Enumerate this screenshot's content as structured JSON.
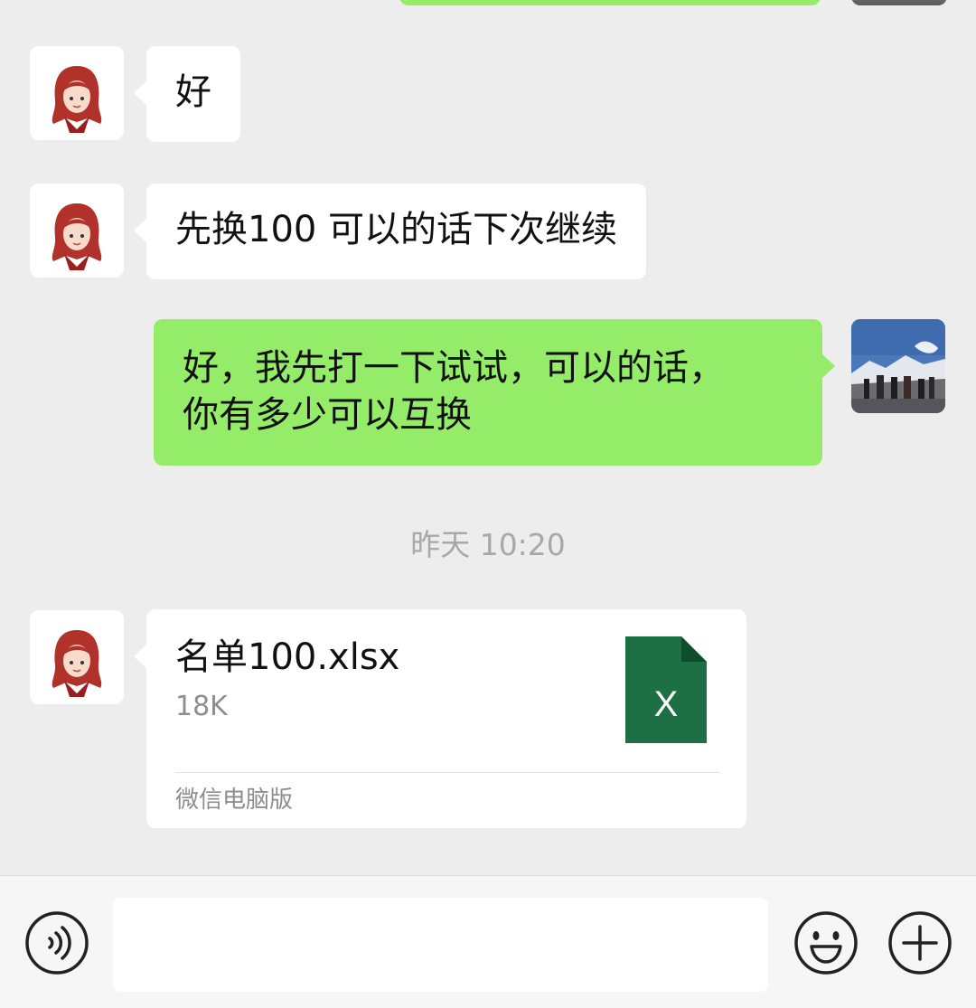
{
  "colors": {
    "chat_background": "#EDEDED",
    "incoming_bubble": "#FFFFFF",
    "outgoing_bubble": "#95EC69",
    "excel_green": "#1D7044"
  },
  "messages": [
    {
      "side": "in",
      "text": "好"
    },
    {
      "side": "in",
      "text": "先换100 可以的话下次继续"
    },
    {
      "side": "out",
      "lines": [
        "好，我先打一下试试，可以的话，",
        "你有多少可以互换"
      ]
    }
  ],
  "timestamp": "昨天 10:20",
  "file_message": {
    "name": "名单100.xlsx",
    "size": "18K",
    "icon": "excel-file-icon",
    "icon_letter": "X",
    "source": "微信电脑版"
  },
  "input_bar": {
    "voice_icon": "voice-icon",
    "emoji_icon": "emoji-icon",
    "plus_icon": "plus-icon"
  }
}
